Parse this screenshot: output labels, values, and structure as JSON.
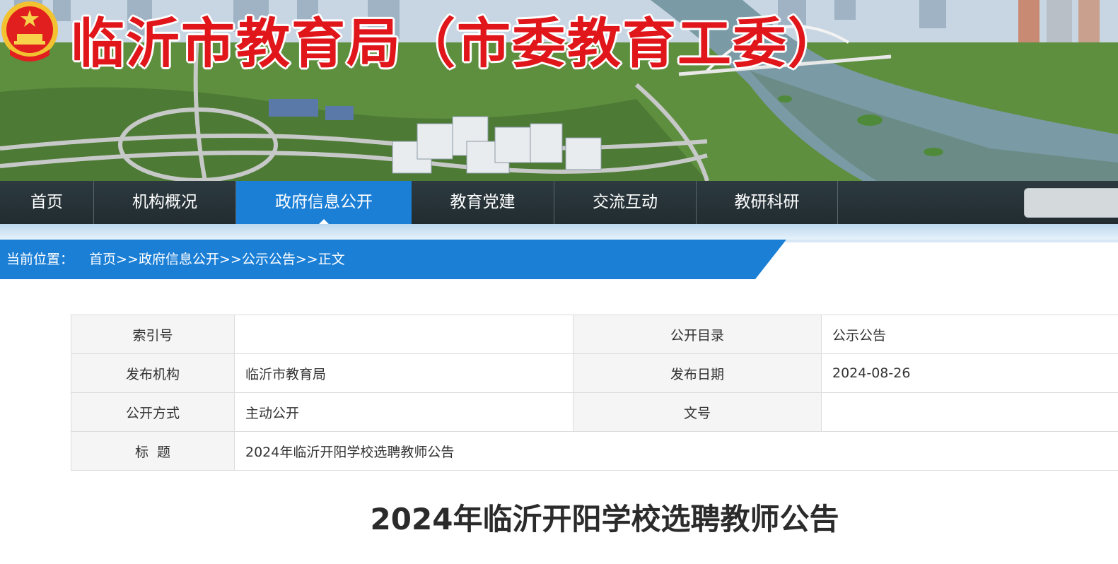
{
  "banner": {
    "site_title": "临沂市教育局（市委教育工委）"
  },
  "nav": {
    "items": [
      {
        "label": "首页",
        "active": false
      },
      {
        "label": "机构概况",
        "active": false
      },
      {
        "label": "政府信息公开",
        "active": true
      },
      {
        "label": "教育党建",
        "active": false
      },
      {
        "label": "交流互动",
        "active": false
      },
      {
        "label": "教研科研",
        "active": false
      }
    ],
    "search_placeholder": ""
  },
  "breadcrumb": {
    "prefix": "当前位置：",
    "items": [
      "首页",
      "政府信息公开",
      "公示公告",
      "正文"
    ],
    "separator": ">>"
  },
  "info": {
    "index_label": "索引号",
    "index_value": "",
    "catalog_label": "公开目录",
    "catalog_value": "公示公告",
    "publisher_label": "发布机构",
    "publisher_value": "临沂市教育局",
    "date_label": "发布日期",
    "date_value": "2024-08-26",
    "mode_label": "公开方式",
    "mode_value": "主动公开",
    "docno_label": "文号",
    "docno_value": "",
    "title_label": "标  题",
    "title_value": "2024年临沂开阳学校选聘教师公告"
  },
  "article": {
    "title": "2024年临沂开阳学校选聘教师公告"
  },
  "colors": {
    "brand_blue": "#1b7fd6",
    "nav_dark": "#252f33",
    "title_red": "#e0161b"
  }
}
